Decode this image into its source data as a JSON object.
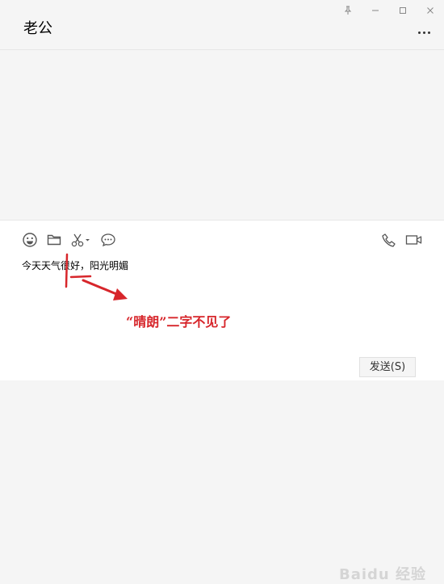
{
  "window": {
    "controls": [
      "pin-icon",
      "minimize-icon",
      "maximize-icon",
      "close-icon"
    ]
  },
  "chat": {
    "title": "老公",
    "more_icon": "more-dots-icon"
  },
  "toolbar": {
    "left": [
      "emoji-icon",
      "folder-icon",
      "scissors-icon",
      "chat-history-icon"
    ],
    "right": [
      "phone-icon",
      "video-icon"
    ]
  },
  "input": {
    "text": "今天天气很好，阳光明媚"
  },
  "send_button": {
    "label": "发送(S)"
  },
  "annotation": {
    "text": "“晴朗”二字不见了",
    "color": "#d7262b"
  },
  "watermark": {
    "text": "Baidu 经验"
  },
  "colors": {
    "background": "#f5f5f5",
    "input_background": "#ffffff",
    "icon": "#555555",
    "annotation": "#d7262b"
  }
}
